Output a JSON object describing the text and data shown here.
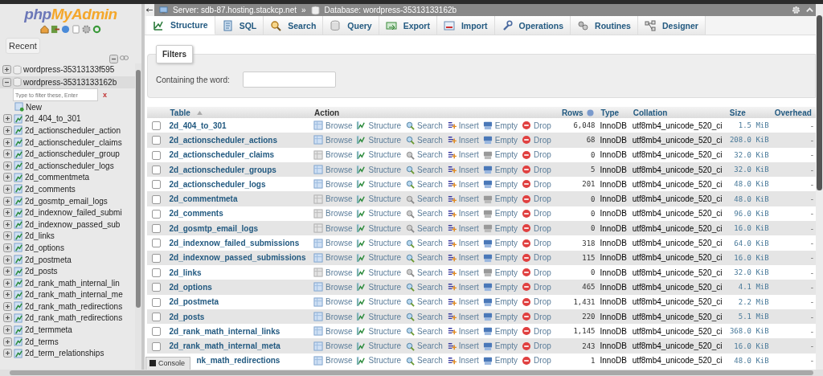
{
  "breadcrumb": {
    "server": "Server: sdb-87.hosting.stackcp.net",
    "separator": "»",
    "database": "Database: wordpress-35313133162b"
  },
  "sidebar": {
    "logo": {
      "first": "php",
      "second": "MyAdmin"
    },
    "recent": "Recent",
    "databases": [
      {
        "name": "wordpress-35313133f595",
        "expanded": false
      },
      {
        "name": "wordpress-35313133162b",
        "expanded": true,
        "filter_placeholder": "Type to filter these, Enter",
        "clear": "x",
        "new": "New",
        "children": [
          {
            "name": "2d_404_to_301"
          },
          {
            "name": "2d_actionscheduler_action"
          },
          {
            "name": "2d_actionscheduler_claims"
          },
          {
            "name": "2d_actionscheduler_group"
          },
          {
            "name": "2d_actionscheduler_logs"
          },
          {
            "name": "2d_commentmeta"
          },
          {
            "name": "2d_comments"
          },
          {
            "name": "2d_gosmtp_email_logs"
          },
          {
            "name": "2d_indexnow_failed_submi"
          },
          {
            "name": "2d_indexnow_passed_sub"
          },
          {
            "name": "2d_links"
          },
          {
            "name": "2d_options"
          },
          {
            "name": "2d_postmeta"
          },
          {
            "name": "2d_posts"
          },
          {
            "name": "2d_rank_math_internal_lin"
          },
          {
            "name": "2d_rank_math_internal_me"
          },
          {
            "name": "2d_rank_math_redirections"
          },
          {
            "name": "2d_rank_math_redirections"
          },
          {
            "name": "2d_termmeta"
          },
          {
            "name": "2d_terms"
          },
          {
            "name": "2d_term_relationships"
          }
        ]
      }
    ]
  },
  "tabs": [
    {
      "label": "Structure",
      "selected": true
    },
    {
      "label": "SQL",
      "selected": false
    },
    {
      "label": "Search",
      "selected": false
    },
    {
      "label": "Query",
      "selected": false
    },
    {
      "label": "Export",
      "selected": false
    },
    {
      "label": "Import",
      "selected": false
    },
    {
      "label": "Operations",
      "selected": false
    },
    {
      "label": "Routines",
      "selected": false
    },
    {
      "label": "Designer",
      "selected": false
    }
  ],
  "filters": {
    "title": "Filters",
    "label": "Containing the word:"
  },
  "table": {
    "columns": [
      "Table",
      "Action",
      "Rows",
      "Type",
      "Collation",
      "Size",
      "Overhead"
    ],
    "rows": [
      {
        "checked": false,
        "name": "2d_404_to_301",
        "empty": false,
        "actions": [
          "Browse",
          "Structure",
          "Search",
          "Insert",
          "Empty",
          "Drop"
        ],
        "rows": "6,048",
        "type": "InnoDB",
        "collation": "utf8mb4_unicode_520_ci",
        "size": "1.5 MiB",
        "overhead": "-"
      },
      {
        "checked": false,
        "name": "2d_actionscheduler_actions",
        "empty": false,
        "actions": [
          "Browse",
          "Structure",
          "Search",
          "Insert",
          "Empty",
          "Drop"
        ],
        "rows": "68",
        "type": "InnoDB",
        "collation": "utf8mb4_unicode_520_ci",
        "size": "208.0 KiB",
        "overhead": "-"
      },
      {
        "checked": false,
        "name": "2d_actionscheduler_claims",
        "empty": true,
        "actions": [
          "Browse",
          "Structure",
          "Search",
          "Insert",
          "Empty",
          "Drop"
        ],
        "rows": "0",
        "type": "InnoDB",
        "collation": "utf8mb4_unicode_520_ci",
        "size": "32.0 KiB",
        "overhead": "-"
      },
      {
        "checked": false,
        "name": "2d_actionscheduler_groups",
        "empty": false,
        "actions": [
          "Browse",
          "Structure",
          "Search",
          "Insert",
          "Empty",
          "Drop"
        ],
        "rows": "5",
        "type": "InnoDB",
        "collation": "utf8mb4_unicode_520_ci",
        "size": "32.0 KiB",
        "overhead": "-"
      },
      {
        "checked": false,
        "name": "2d_actionscheduler_logs",
        "empty": false,
        "actions": [
          "Browse",
          "Structure",
          "Search",
          "Insert",
          "Empty",
          "Drop"
        ],
        "rows": "201",
        "type": "InnoDB",
        "collation": "utf8mb4_unicode_520_ci",
        "size": "48.0 KiB",
        "overhead": "-"
      },
      {
        "checked": false,
        "name": "2d_commentmeta",
        "empty": true,
        "actions": [
          "Browse",
          "Structure",
          "Search",
          "Insert",
          "Empty",
          "Drop"
        ],
        "rows": "0",
        "type": "InnoDB",
        "collation": "utf8mb4_unicode_520_ci",
        "size": "48.0 KiB",
        "overhead": "-"
      },
      {
        "checked": false,
        "name": "2d_comments",
        "empty": true,
        "actions": [
          "Browse",
          "Structure",
          "Search",
          "Insert",
          "Empty",
          "Drop"
        ],
        "rows": "0",
        "type": "InnoDB",
        "collation": "utf8mb4_unicode_520_ci",
        "size": "96.0 KiB",
        "overhead": "-"
      },
      {
        "checked": false,
        "name": "2d_gosmtp_email_logs",
        "empty": true,
        "actions": [
          "Browse",
          "Structure",
          "Search",
          "Insert",
          "Empty",
          "Drop"
        ],
        "rows": "0",
        "type": "InnoDB",
        "collation": "utf8mb4_unicode_520_ci",
        "size": "16.0 KiB",
        "overhead": "-"
      },
      {
        "checked": false,
        "name": "2d_indexnow_failed_submissions",
        "empty": false,
        "actions": [
          "Browse",
          "Structure",
          "Search",
          "Insert",
          "Empty",
          "Drop"
        ],
        "rows": "318",
        "type": "InnoDB",
        "collation": "utf8mb4_unicode_520_ci",
        "size": "64.0 KiB",
        "overhead": "-"
      },
      {
        "checked": false,
        "name": "2d_indexnow_passed_submissions",
        "empty": false,
        "actions": [
          "Browse",
          "Structure",
          "Search",
          "Insert",
          "Empty",
          "Drop"
        ],
        "rows": "115",
        "type": "InnoDB",
        "collation": "utf8mb4_unicode_520_ci",
        "size": "16.0 KiB",
        "overhead": "-"
      },
      {
        "checked": false,
        "name": "2d_links",
        "empty": true,
        "actions": [
          "Browse",
          "Structure",
          "Search",
          "Insert",
          "Empty",
          "Drop"
        ],
        "rows": "0",
        "type": "InnoDB",
        "collation": "utf8mb4_unicode_520_ci",
        "size": "32.0 KiB",
        "overhead": "-"
      },
      {
        "checked": false,
        "name": "2d_options",
        "empty": false,
        "actions": [
          "Browse",
          "Structure",
          "Search",
          "Insert",
          "Empty",
          "Drop"
        ],
        "rows": "465",
        "type": "InnoDB",
        "collation": "utf8mb4_unicode_520_ci",
        "size": "4.1 MiB",
        "overhead": "-"
      },
      {
        "checked": false,
        "name": "2d_postmeta",
        "empty": false,
        "actions": [
          "Browse",
          "Structure",
          "Search",
          "Insert",
          "Empty",
          "Drop"
        ],
        "rows": "1,431",
        "type": "InnoDB",
        "collation": "utf8mb4_unicode_520_ci",
        "size": "2.2 MiB",
        "overhead": "-"
      },
      {
        "checked": false,
        "name": "2d_posts",
        "empty": false,
        "actions": [
          "Browse",
          "Structure",
          "Search",
          "Insert",
          "Empty",
          "Drop"
        ],
        "rows": "220",
        "type": "InnoDB",
        "collation": "utf8mb4_unicode_520_ci",
        "size": "5.1 MiB",
        "overhead": "-"
      },
      {
        "checked": false,
        "name": "2d_rank_math_internal_links",
        "empty": false,
        "actions": [
          "Browse",
          "Structure",
          "Search",
          "Insert",
          "Empty",
          "Drop"
        ],
        "rows": "1,145",
        "type": "InnoDB",
        "collation": "utf8mb4_unicode_520_ci",
        "size": "368.0 KiB",
        "overhead": "-"
      },
      {
        "checked": false,
        "name": "2d_rank_math_internal_meta",
        "empty": false,
        "actions": [
          "Browse",
          "Structure",
          "Search",
          "Insert",
          "Empty",
          "Drop"
        ],
        "rows": "243",
        "type": "InnoDB",
        "collation": "utf8mb4_unicode_520_ci",
        "size": "16.0 KiB",
        "overhead": "-"
      },
      {
        "name": "nk_math_redirections",
        "empty": false,
        "actions": [
          "Browse",
          "Structure",
          "Search",
          "Insert",
          "Empty",
          "Drop"
        ],
        "rows": "1",
        "type": "InnoDB",
        "collation": "utf8mb4_unicode_520_ci",
        "size": "48.0 KiB",
        "overhead": "-"
      }
    ]
  },
  "console": "Console"
}
